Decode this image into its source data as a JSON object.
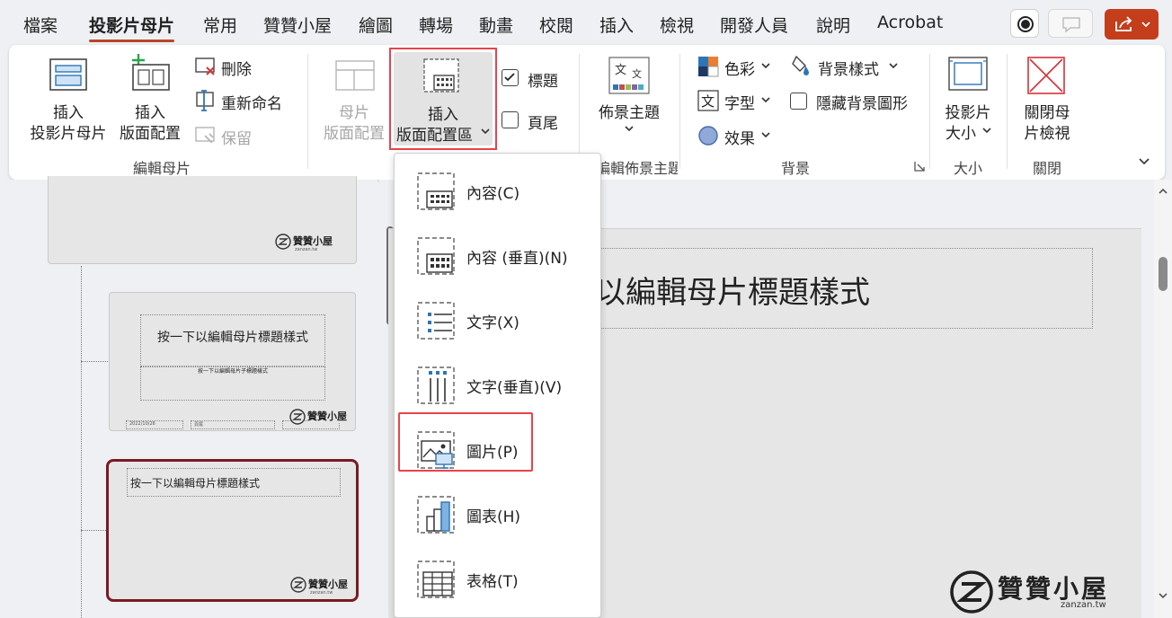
{
  "tabs": [
    {
      "label": "檔案",
      "active": false
    },
    {
      "label": "投影片母片",
      "active": true
    },
    {
      "label": "常用",
      "active": false
    },
    {
      "label": "贊贊小屋",
      "active": false
    },
    {
      "label": "繪圖",
      "active": false
    },
    {
      "label": "轉場",
      "active": false
    },
    {
      "label": "動畫",
      "active": false
    },
    {
      "label": "校閱",
      "active": false
    },
    {
      "label": "插入",
      "active": false
    },
    {
      "label": "檢視",
      "active": false
    },
    {
      "label": "開發人員",
      "active": false
    },
    {
      "label": "說明",
      "active": false
    },
    {
      "label": "Acrobat",
      "active": false
    }
  ],
  "ribbon": {
    "edit_master": {
      "insert_master_l1": "插入",
      "insert_master_l2": "投影片母片",
      "insert_layout_l1": "插入",
      "insert_layout_l2": "版面配置",
      "delete": "刪除",
      "rename": "重新命名",
      "preserve": "保留",
      "group_label": "編輯母片"
    },
    "master_layout": {
      "master_layout_l1": "母片",
      "master_layout_l2": "版面配置",
      "insert_placeholder_l1": "插入",
      "insert_placeholder_l2": "版面配置區",
      "title_check": "標題",
      "footer_check": "頁尾"
    },
    "edit_theme": {
      "themes": "佈景主題",
      "group_label": "編輯佈景主題"
    },
    "background": {
      "colors": "色彩",
      "fonts": "字型",
      "effects": "效果",
      "bg_styles": "背景樣式",
      "hide_bg": "隱藏背景圖形",
      "group_label": "背景"
    },
    "size": {
      "slide_size_l1": "投影片",
      "slide_size_l2": "大小",
      "group_label": "大小"
    },
    "close": {
      "close_l1": "關閉母",
      "close_l2": "片檢視",
      "group_label": "關閉"
    }
  },
  "menu": {
    "items": [
      {
        "label": "內容(C)",
        "icon": "content-placeholder-icon"
      },
      {
        "label": "內容 (垂直)(N)",
        "icon": "content-vertical-placeholder-icon"
      },
      {
        "label": "文字(X)",
        "icon": "text-placeholder-icon"
      },
      {
        "label": "文字(垂直)(V)",
        "icon": "text-vertical-placeholder-icon"
      },
      {
        "label": "圖片(P)",
        "icon": "picture-placeholder-icon"
      },
      {
        "label": "圖表(H)",
        "icon": "chart-placeholder-icon"
      },
      {
        "label": "表格(T)",
        "icon": "table-placeholder-icon"
      }
    ]
  },
  "thumbnails": {
    "logo_text": "贊贊小屋",
    "logo_sub": "zanzan.tw",
    "thumb2_title": "按一下以編輯母片標題樣式",
    "thumb2_sub": "按一下以編輯母片子標題樣式",
    "thumb2_date": "2022/10/26",
    "thumb2_footer": "頁尾",
    "thumb3_title": "按一下以編輯母片標題樣式"
  },
  "slide": {
    "title_text": "以編輯母片標題樣式",
    "logo_text": "贊贊小屋",
    "logo_sub": "zanzan.tw"
  },
  "colors": {
    "accent": "#b7472a",
    "share": "#c43e1c",
    "highlight": "#e8434b",
    "selected_thumb": "#7a1a22"
  }
}
